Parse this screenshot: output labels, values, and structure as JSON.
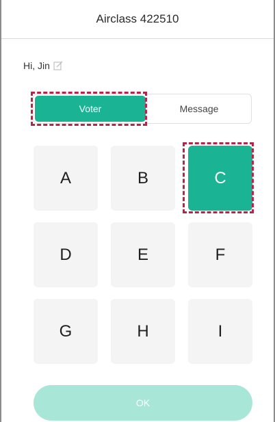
{
  "header": {
    "title": "Airclass 422510"
  },
  "greeting": {
    "text": "Hi, Jin",
    "edit_icon": "edit-icon"
  },
  "tabs": [
    {
      "label": "Voter",
      "active": true
    },
    {
      "label": "Message",
      "active": false
    }
  ],
  "keypad": {
    "keys": [
      "A",
      "B",
      "C",
      "D",
      "E",
      "F",
      "G",
      "H",
      "I"
    ],
    "selected": "C"
  },
  "ok_button": {
    "label": "OK",
    "enabled": false
  },
  "colors": {
    "accent": "#1ab394",
    "accent_disabled": "#a8e6d8",
    "key_background": "#f4f4f4",
    "highlight_dash": "#b3264a"
  }
}
